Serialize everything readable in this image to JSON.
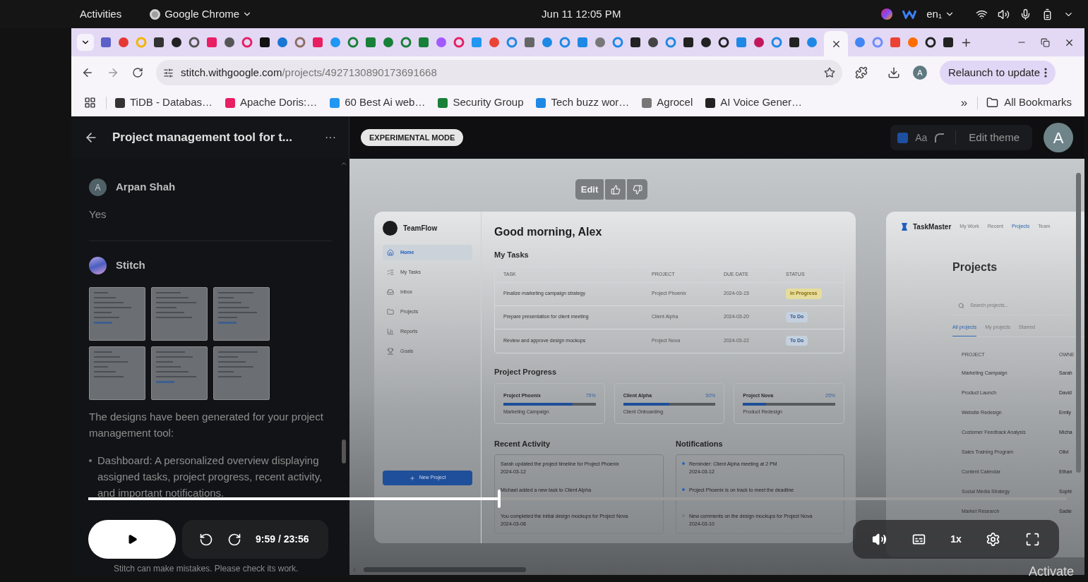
{
  "system_bar": {
    "activities": "Activities",
    "app_menu": "Google Chrome",
    "clock": "Jun 11  12:05 PM",
    "keyboard": "en₁"
  },
  "browser": {
    "url_domain": "stitch.withgoogle.com",
    "url_path": "/projects/4927130890173691668",
    "relaunch": "Relaunch to update",
    "profile_initial": "A",
    "bookmarks": [
      {
        "label": "TiDB - Databas…"
      },
      {
        "label": "Apache Doris:…"
      },
      {
        "label": "60 Best Ai web…"
      },
      {
        "label": "Security Group"
      },
      {
        "label": "Tech buzz wor…"
      },
      {
        "label": "Agrocel"
      },
      {
        "label": "AI Voice Gener…"
      }
    ],
    "overflow": "»",
    "all_bookmarks": "All Bookmarks"
  },
  "app_header": {
    "title": "Project management tool for t...",
    "menu": "···",
    "mode_badge": "EXPERIMENTAL MODE",
    "theme_font": "Aa",
    "edit_theme": "Edit theme",
    "avatar": "A"
  },
  "chat": {
    "messages": [
      {
        "kind": "user",
        "avatar": "A",
        "author": "Arpan Shah",
        "text": "Yes"
      },
      {
        "kind": "agent",
        "author": "Stitch",
        "text": "The designs have been generated for your project management tool:",
        "bullets": [
          "Dashboard: A personalized overview displaying assigned tasks, project progress, recent activity, and important notifications."
        ]
      }
    ],
    "disclaimer": "Stitch can make mistakes. Please check its work."
  },
  "canvas": {
    "toolbar": {
      "edit": "Edit"
    },
    "dashboard": {
      "brand": "TeamFlow",
      "nav": [
        {
          "label": "Home",
          "selected": true
        },
        {
          "label": "My Tasks",
          "selected": false
        },
        {
          "label": "Inbox",
          "selected": false
        },
        {
          "label": "Projects",
          "selected": false
        },
        {
          "label": "Reports",
          "selected": false
        },
        {
          "label": "Goals",
          "selected": false
        }
      ],
      "new_project": "New Project",
      "greeting": "Good morning, Alex",
      "tasks_title": "My Tasks",
      "table": {
        "columns": [
          "TASK",
          "PROJECT",
          "DUE DATE",
          "STATUS"
        ],
        "rows": [
          {
            "task": "Finalize marketing campaign strategy",
            "project": "Project Phoenix",
            "due": "2024-03-15",
            "status": "In Progress",
            "kind": "in_progress"
          },
          {
            "task": "Prepare presentation for client meeting",
            "project": "Client Alpha",
            "due": "2024-03-20",
            "status": "To Do",
            "kind": "todo"
          },
          {
            "task": "Review and approve design mockups",
            "project": "Project Nova",
            "due": "2024-03-22",
            "status": "To Do",
            "kind": "todo"
          }
        ]
      },
      "progress_title": "Project Progress",
      "progress": [
        {
          "name": "Project Phoenix",
          "percent": "75%",
          "level": 0.75,
          "subtitle": "Marketing Campaign"
        },
        {
          "name": "Client Alpha",
          "percent": "50%",
          "level": 0.5,
          "subtitle": "Client Onboarding"
        },
        {
          "name": "Project Nova",
          "percent": "25%",
          "level": 0.25,
          "subtitle": "Product Redesign"
        }
      ],
      "activity_title": "Recent Activity",
      "activity": [
        {
          "text": "Sarah updated the project timeline for Project Phoenix",
          "date": "2024-03-12"
        },
        {
          "text": "Michael added a new task to Client Alpha"
        },
        {
          "text": "You completed the initial design mockups for Project Nova",
          "date": "2024-03-08"
        }
      ],
      "notifications_title": "Notifications",
      "notifications": [
        {
          "text": "Reminder: Client Alpha meeting at 2 PM",
          "date": "2024-03-12",
          "unread": true
        },
        {
          "text": "Project Phoenix is on track to meet the deadline",
          "unread": true
        },
        {
          "text": "New comments on the design mockups for Project Nova",
          "date": "2024-03-10",
          "unread": false
        }
      ]
    },
    "projects_screen": {
      "brand": "TaskMaster",
      "nav": [
        {
          "label": "My Work",
          "selected": false
        },
        {
          "label": "Recent",
          "selected": false
        },
        {
          "label": "Projects",
          "selected": true
        },
        {
          "label": "Team",
          "selected": false
        }
      ],
      "title": "Projects",
      "search_placeholder": "Search projects...",
      "tabs": [
        {
          "label": "All projects",
          "selected": true
        },
        {
          "label": "My projects",
          "selected": false
        },
        {
          "label": "Starred",
          "selected": false
        }
      ],
      "columns": [
        "PROJECT",
        "OWNE"
      ],
      "rows": [
        {
          "project": "Marketing Campaign",
          "owner": "Sarah"
        },
        {
          "project": "Product Launch",
          "owner": "David"
        },
        {
          "project": "Website Redesign",
          "owner": "Emily"
        },
        {
          "project": "Customer Feedback Analysis",
          "owner": "Micha"
        },
        {
          "project": "Sales Training Program",
          "owner": "Olivi"
        },
        {
          "project": "Content Calendar",
          "owner": "Ethan"
        },
        {
          "project": "Social Media Strategy",
          "owner": "Sophi"
        },
        {
          "project": "Market Research",
          "owner": "Sadie"
        }
      ]
    }
  },
  "player": {
    "paused": true,
    "level": 0.42,
    "current": "9:59",
    "total": "/ 23:56",
    "speed": "1x"
  },
  "os_notice": "Activate"
}
